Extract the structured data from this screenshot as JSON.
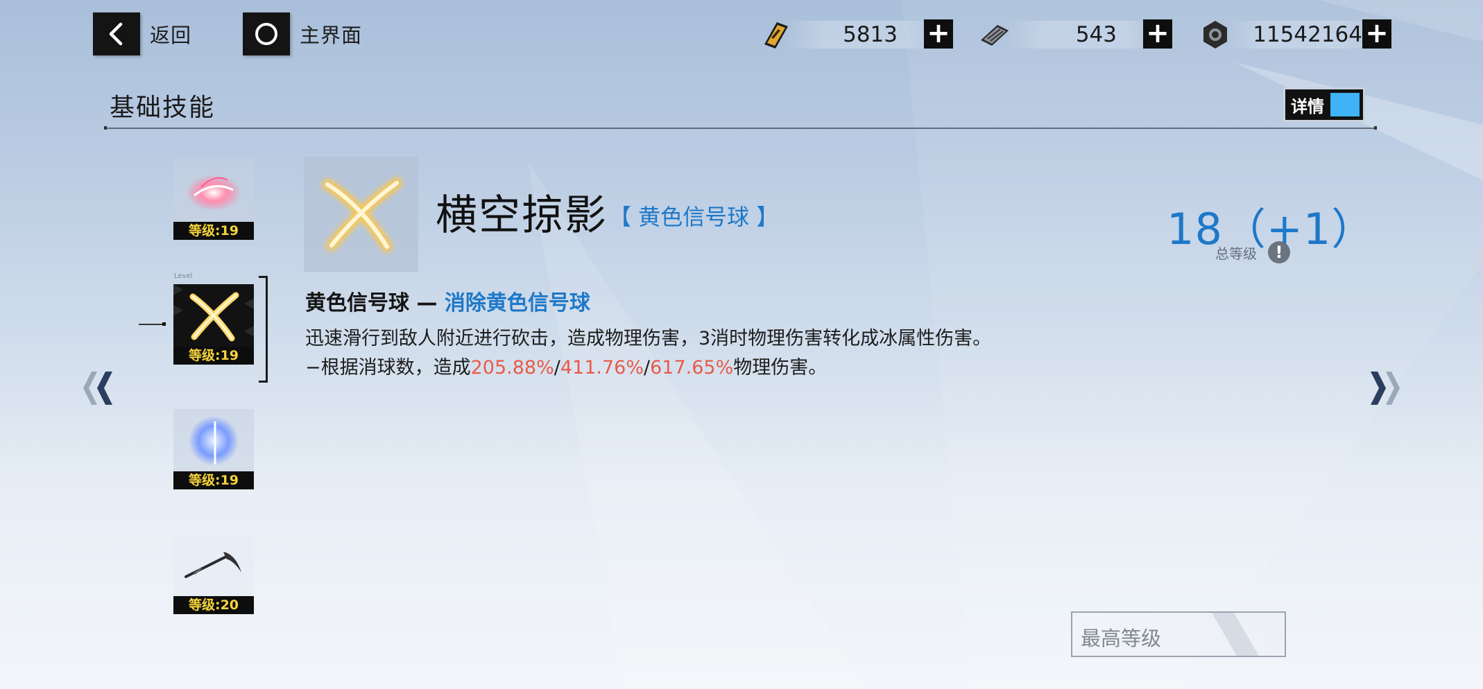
{
  "nav": {
    "back_label": "返回",
    "home_label": "主界面"
  },
  "resources": [
    {
      "icon": "stamina-card-icon",
      "value": "5813"
    },
    {
      "icon": "chip-card-icon",
      "value": "543"
    },
    {
      "icon": "gear-nut-icon",
      "value": "11542164"
    }
  ],
  "section": {
    "title": "基础技能",
    "detail_toggle_label": "详情"
  },
  "skills": [
    {
      "level_label": "等级:19",
      "icon": "pink-burst-skill-icon"
    },
    {
      "level_label": "等级:19",
      "icon": "golden-cross-slash-skill-icon",
      "selected": true,
      "tag": "Level"
    },
    {
      "level_label": "等级:19",
      "icon": "blue-crescent-skill-icon"
    },
    {
      "level_label": "等级:20",
      "icon": "scythe-weapon-skill-icon"
    }
  ],
  "detail": {
    "name": "横空掠影",
    "tag": "【 黄色信号球 】",
    "sub_prefix": "黄色信号球 — ",
    "sub_highlight": "消除黄色信号球",
    "desc_line1": "迅速滑行到敌人附近进行砍击，造成物理伤害，3消时物理伤害转化成冰属性伤害。",
    "desc_line2_prefix": "−根据消球数，造成",
    "desc_val1": "205.88%",
    "sep1": "/",
    "desc_val2": "411.76%",
    "sep2": "/",
    "desc_val3": "617.65%",
    "desc_line2_suffix": "物理伤害。",
    "total_level": "18（+1）",
    "total_level_label": "总等级",
    "info_icon": "!"
  },
  "max_level_button": "最高等级",
  "colors": {
    "accent_blue": "#1e78c8",
    "damage_red": "#ea5a48",
    "level_yellow": "#f6d43a"
  }
}
